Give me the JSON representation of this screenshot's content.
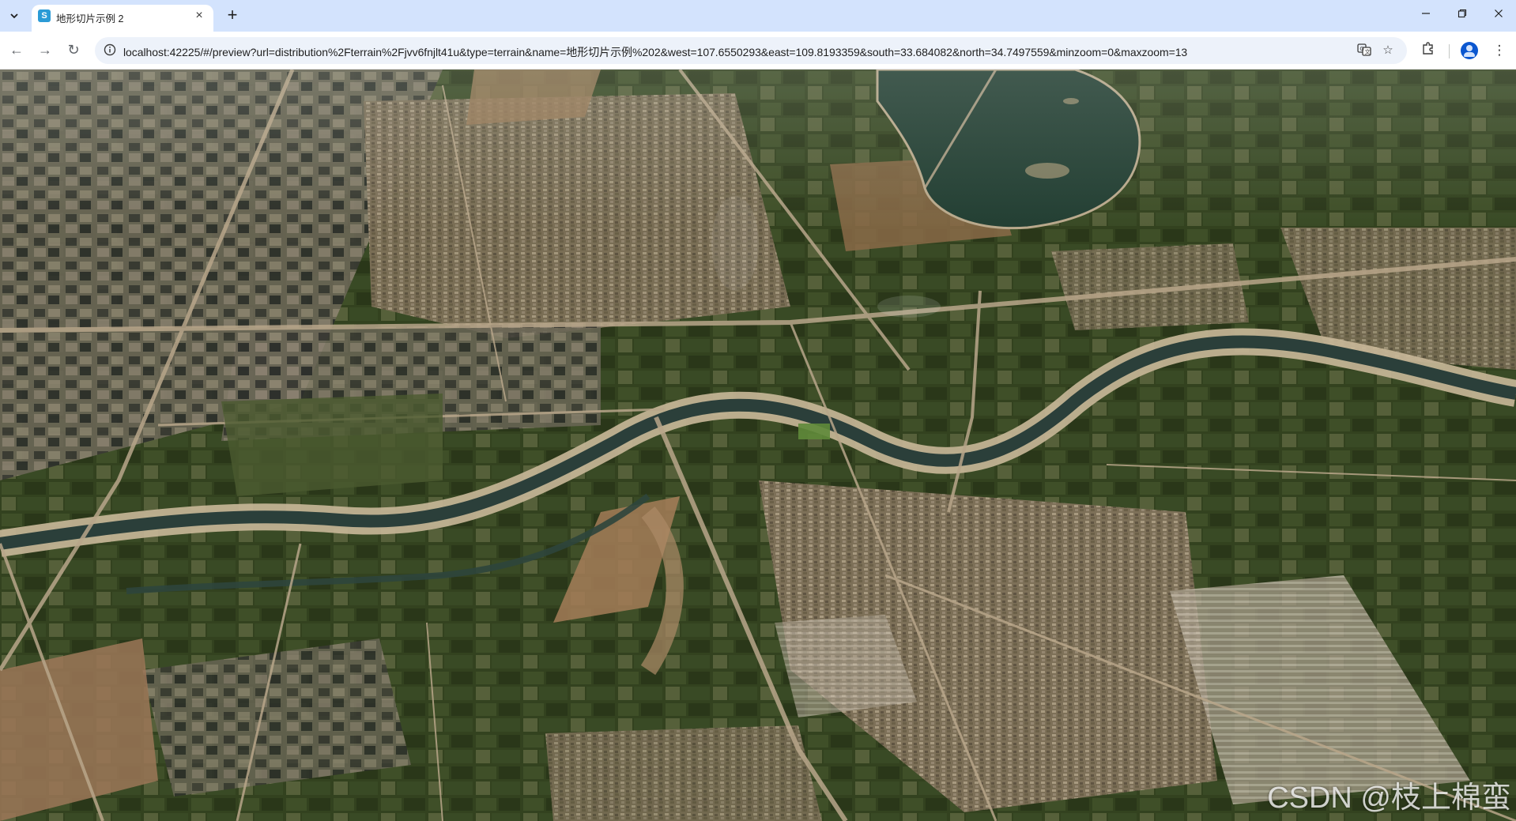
{
  "browser": {
    "tab": {
      "title": "地形切片示例 2",
      "favicon_icon": "app-logo-icon",
      "close_icon": "close-icon"
    },
    "new_tab_icon": "plus-icon",
    "tab_search_icon": "chevron-down-icon",
    "window_controls": [
      "minimize-icon",
      "restore-icon",
      "close-icon"
    ],
    "nav": [
      "back-icon",
      "forward-icon",
      "reload-icon"
    ],
    "address_bar": {
      "url": "localhost:42225/#/preview?url=distribution%2Fterrain%2Fjvv6fnjlt41u&type=terrain&name=地形切片示例%202&west=107.6550293&east=109.8193359&south=33.684082&north=34.7497559&minzoom=0&maxzoom=13",
      "site_info_icon": "info-icon"
    },
    "toolbar_icons": [
      "translate-icon",
      "bookmark-star-icon",
      "extensions-icon",
      "profile-avatar-icon",
      "more-menu-icon"
    ]
  },
  "map": {
    "description_type": "3D terrain satellite imagery preview",
    "watermark": "CSDN @枝上棉蛮",
    "colors": {
      "farmland_dark": "#2f3d22",
      "farmland_mid": "#4a5632",
      "urban": "#8a7c62",
      "bare_soil": "#9a7a58",
      "water": "#2a4a3a",
      "road": "#b8a68a"
    }
  }
}
